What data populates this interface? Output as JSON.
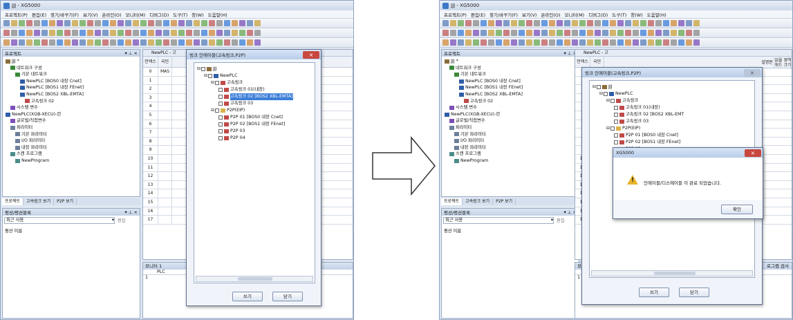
{
  "window_title_left": "JJJ - XG5000",
  "window_title_right": "JJJ - XG5000",
  "menu": [
    "프로젝트(P)",
    "편집(E)",
    "찾기/바꾸기(F)",
    "보기(V)",
    "온라인(O)",
    "모니터(M)",
    "디버그(D)",
    "도구(T)",
    "창(W)",
    "도움말(H)"
  ],
  "project_pane": {
    "title": "프로젝트",
    "pin": "▾ ⊥ ×",
    "tree": [
      {
        "depth": 0,
        "icon": "proj",
        "label": "JJJ *"
      },
      {
        "depth": 1,
        "icon": "net",
        "label": "네트워크 구성"
      },
      {
        "depth": 2,
        "icon": "net",
        "label": "기본 네트워크"
      },
      {
        "depth": 3,
        "icon": "plc",
        "label": "NewPLC [BOS0 내장 Cnet]"
      },
      {
        "depth": 3,
        "icon": "plc",
        "label": "NewPLC [BOS1 내장 FEnet]"
      },
      {
        "depth": 3,
        "icon": "plc",
        "label": "NewPLC [BOS2 XBL-EMTA]"
      },
      {
        "depth": 4,
        "icon": "link",
        "label": "고속링크 02"
      },
      {
        "depth": 1,
        "icon": "var",
        "label": "시스템 변수"
      },
      {
        "depth": 0,
        "icon": "plc",
        "label": "NewPLC(XGB-XECU)-런"
      },
      {
        "depth": 1,
        "icon": "var",
        "label": "글로벌/직접변수"
      },
      {
        "depth": 1,
        "icon": "param",
        "label": "파라미터"
      },
      {
        "depth": 2,
        "icon": "param",
        "label": "기본 파라미터"
      },
      {
        "depth": 2,
        "icon": "param",
        "label": "I/O 파라미터"
      },
      {
        "depth": 2,
        "icon": "param",
        "label": "내장 파라미터"
      },
      {
        "depth": 1,
        "icon": "prog",
        "label": "스캔 프로그램"
      },
      {
        "depth": 2,
        "icon": "prog",
        "label": "NewProgram"
      }
    ],
    "tabs": [
      "프로젝트",
      "고속링크 보기",
      "P2P 보기"
    ]
  },
  "recent_pane": {
    "title": "평션/평션블록",
    "pin": "▾ ⊥ ×",
    "combo": "최근 사용",
    "edit_btn": "편집",
    "column": "평션 이름"
  },
  "grid": {
    "doc_tab_left": "NewPLC - 고",
    "doc_tab_right": "NewPLC - 고",
    "header_index": "인덱스",
    "header_type": "국던",
    "extra_headers": [
      "설명문",
      "읽을 영역 워드 크기"
    ],
    "rows": [
      "0",
      "1",
      "2",
      "3",
      "4",
      "5",
      "6",
      "7",
      "8",
      "9",
      "10",
      "11",
      "12",
      "13",
      "14",
      "15",
      "16",
      "17"
    ],
    "first_row_value": "MAS"
  },
  "monitor": {
    "title": "모니터 1",
    "col": "PLC",
    "row": "1",
    "right_label": "로그램 검사"
  },
  "link_dialog": {
    "title": "링크 인에이블(고속링크,P2P)",
    "close": "×",
    "tree": [
      {
        "depth": 0,
        "label": "JJJ",
        "icon": "proj"
      },
      {
        "depth": 1,
        "label": "NewPLC",
        "icon": "plc"
      },
      {
        "depth": 2,
        "label": "고속링크",
        "icon": "link"
      },
      {
        "depth": 3,
        "label": "고속링크 01(내장)",
        "icon": "link"
      },
      {
        "depth": 3,
        "label": "고속링크 02 [BOS2 XBL-EMTA]",
        "icon": "link",
        "selected": true
      },
      {
        "depth": 3,
        "label": "고속링크 03",
        "icon": "link"
      },
      {
        "depth": 2,
        "label": "P2P(EIP)",
        "icon": "fold"
      },
      {
        "depth": 3,
        "label": "P2P 01 [BOS0 내장 Cnet]",
        "icon": "link"
      },
      {
        "depth": 3,
        "label": "P2P 02 [BOS1 내장 FEnet]",
        "icon": "link"
      },
      {
        "depth": 3,
        "label": "P2P 03",
        "icon": "link"
      },
      {
        "depth": 3,
        "label": "P2P 04",
        "icon": "link"
      }
    ],
    "right_tree_selected_label": "고속링크 02 [BOS2 XBL-EMT",
    "write_btn": "쓰기",
    "close_btn": "닫기",
    "scroll_label": "|||"
  },
  "message_box": {
    "title": "XG5000",
    "close": "×",
    "text": "인에이블/디스에이블 이 완료 되었습니다.",
    "ok": "확인",
    "icon": "warning-icon"
  },
  "colors": {
    "accent": "#3c7ed8",
    "close_red": "#c8473e",
    "warning": "#e7b52c"
  }
}
